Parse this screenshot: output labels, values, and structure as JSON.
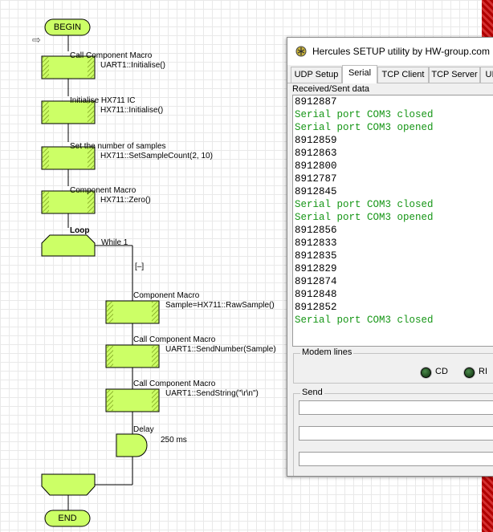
{
  "flowchart": {
    "begin": "BEGIN",
    "end": "END",
    "steps": [
      {
        "label": "Call Component Macro",
        "macro": "UART1::Initialise()"
      },
      {
        "label": "Initialise HX711 IC",
        "macro": "HX711::Initialise()"
      },
      {
        "label": "Set the number of samples",
        "macro": "HX711::SetSampleCount(2, 10)"
      },
      {
        "label": "Component Macro",
        "macro": "HX711::Zero()"
      }
    ],
    "loop": {
      "label": "Loop",
      "condition": "While 1",
      "collapse": "[–]"
    },
    "loop_steps": [
      {
        "label": "Component Macro",
        "macro": "Sample=HX711::RawSample()"
      },
      {
        "label": "Call Component Macro",
        "macro": "UART1::SendNumber(Sample)"
      },
      {
        "label": "Call Component Macro",
        "macro": "UART1::SendString(\"\\r\\n\")"
      }
    ],
    "delay": {
      "label": "Delay",
      "value": "250 ms"
    },
    "start_marker": "⇨"
  },
  "hercules": {
    "title": "Hercules SETUP utility by HW-group.com",
    "tabs": [
      "UDP Setup",
      "Serial",
      "TCP Client",
      "TCP Server",
      "UI"
    ],
    "active_tab": "Serial",
    "received_label": "Received/Sent data",
    "lines": [
      {
        "text": "8912887",
        "type": "num"
      },
      {
        "text": "Serial port COM3 closed",
        "type": "status"
      },
      {
        "text": "Serial port COM3 opened",
        "type": "status"
      },
      {
        "text": "8912859",
        "type": "num"
      },
      {
        "text": "8912863",
        "type": "num"
      },
      {
        "text": "8912800",
        "type": "num"
      },
      {
        "text": "8912787",
        "type": "num"
      },
      {
        "text": "8912845",
        "type": "num"
      },
      {
        "text": "Serial port COM3 closed",
        "type": "status"
      },
      {
        "text": "Serial port COM3 opened",
        "type": "status"
      },
      {
        "text": "8912856",
        "type": "num"
      },
      {
        "text": "8912833",
        "type": "num"
      },
      {
        "text": "8912835",
        "type": "num"
      },
      {
        "text": "8912829",
        "type": "num"
      },
      {
        "text": "8912874",
        "type": "num"
      },
      {
        "text": "8912848",
        "type": "num"
      },
      {
        "text": "8912852",
        "type": "num"
      },
      {
        "text": "Serial port COM3 closed",
        "type": "status"
      }
    ],
    "modem_label": "Modem lines",
    "leds": [
      "CD",
      "RI"
    ],
    "send_label": "Send"
  },
  "colors": {
    "block_fill": "#ccff66",
    "block_hatch": "#7ea21e",
    "status_text": "#169616"
  }
}
